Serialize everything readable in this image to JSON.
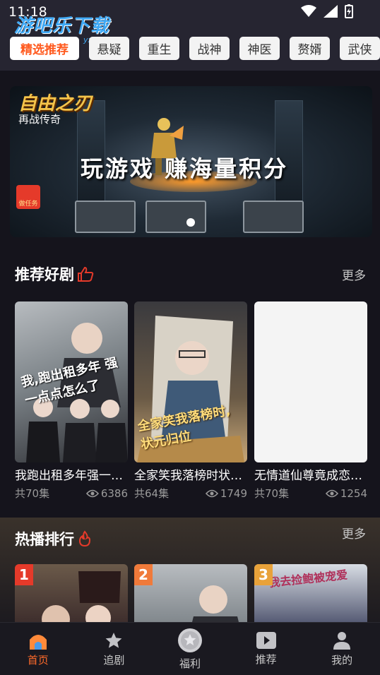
{
  "status_bar": {
    "time": "11:18"
  },
  "watermark": {
    "text": "游吧乐下载",
    "sub": "yxl.com"
  },
  "tabs": [
    {
      "label": "精选推荐",
      "active": true
    },
    {
      "label": "悬疑"
    },
    {
      "label": "重生"
    },
    {
      "label": "战神"
    },
    {
      "label": "神医"
    },
    {
      "label": "赘婿"
    },
    {
      "label": "武侠"
    }
  ],
  "banner": {
    "game_title": "自由之刃",
    "game_subtitle": "再战传奇",
    "headline": "玩游戏  赚海量积分",
    "task_label": "做任务"
  },
  "recommended": {
    "title": "推荐好剧",
    "more_label": "更多",
    "items": [
      {
        "title": "我跑出租多年强一点点怎么了",
        "episodes": "共70集",
        "views": "6386",
        "poster_text": "我,跑出租多年 强一点点怎么了"
      },
      {
        "title": "全家笑我落榜时状元归位",
        "episodes": "共64集",
        "views": "1749",
        "poster_text": "全家笑我落榜时, 状元归位"
      },
      {
        "title": "无情道仙尊竟成恋爱脑",
        "episodes": "共70集",
        "views": "1254",
        "poster_text": ""
      }
    ]
  },
  "hot": {
    "title": "热播排行",
    "more_label": "更多",
    "ranks": [
      "1",
      "2",
      "3"
    ],
    "poster3_text": "我去捡鲍被宠爱"
  },
  "bottom_nav": [
    {
      "label": "首页",
      "icon": "home-icon",
      "active": true
    },
    {
      "label": "追剧",
      "icon": "star-icon"
    },
    {
      "label": "福利",
      "icon": "coin-icon"
    },
    {
      "label": "推荐",
      "icon": "play-icon"
    },
    {
      "label": "我的",
      "icon": "person-icon"
    }
  ],
  "colors": {
    "accent": "#ff6a2a",
    "background": "#15141c",
    "tab_active_text": "#ff5a1f"
  }
}
